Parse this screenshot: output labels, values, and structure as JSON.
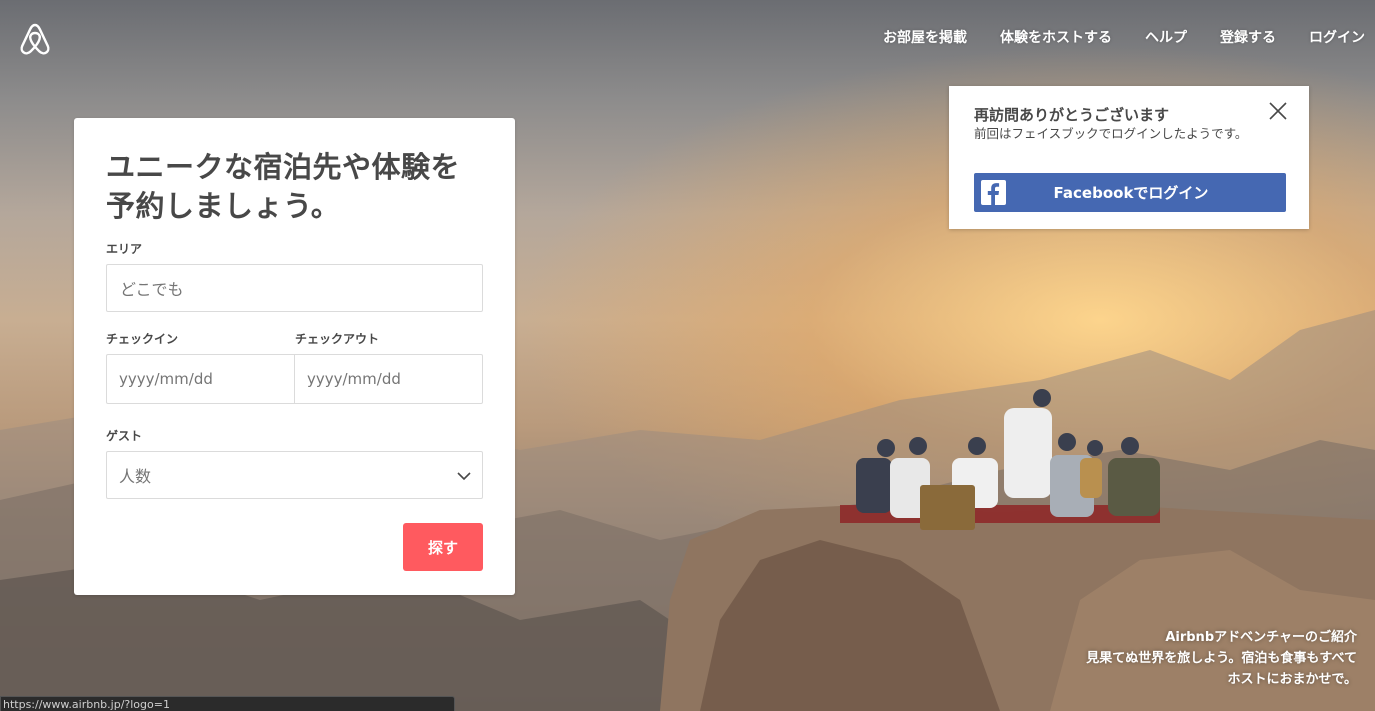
{
  "nav": {
    "items": [
      "お部屋を掲載",
      "体験をホストする",
      "ヘルプ",
      "登録する",
      "ログイン"
    ]
  },
  "search": {
    "heading": "ユニークな宿泊先や体験を予約しましょう。",
    "where_label": "エリア",
    "where_placeholder": "どこでも",
    "checkin_label": "チェックイン",
    "checkin_placeholder": "yyyy/mm/dd",
    "checkout_label": "チェックアウト",
    "checkout_placeholder": "yyyy/mm/dd",
    "guests_label": "ゲスト",
    "guests_value": "人数",
    "search_button": "探す"
  },
  "welcome": {
    "title": "再訪問ありがとうございます",
    "message": "前回はフェイスブックでログインしたようです。",
    "facebook_button": "Facebookでログイン"
  },
  "caption": {
    "line1": "Airbnbアドベンチャーのご紹介",
    "line2": "見果てぬ世界を旅しよう。宿泊も食事もすべて",
    "line3": "ホストにおまかせで。"
  },
  "status_url": "https://www.airbnb.jp/?logo=1",
  "colors": {
    "brand": "#ff5a5f",
    "facebook": "#4568b2",
    "text": "#484848"
  }
}
